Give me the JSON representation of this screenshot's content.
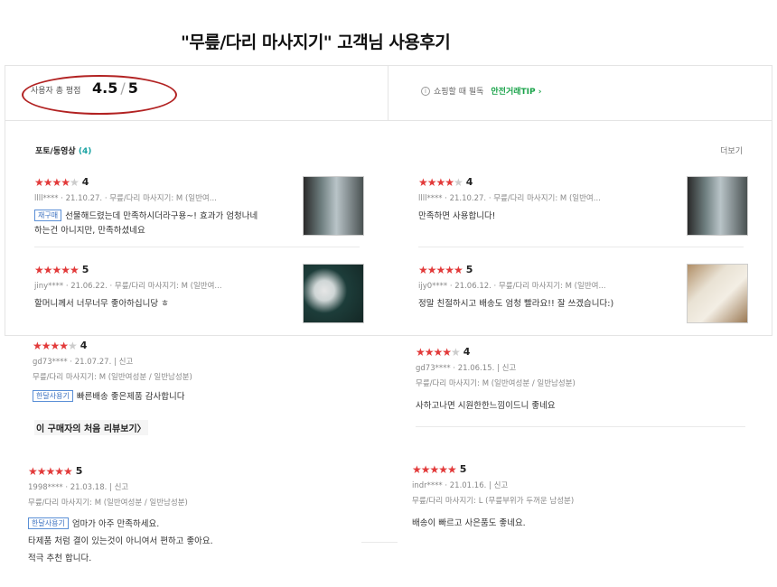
{
  "title": "\"무릎/다리 마사지기\" 고객님 사용후기",
  "summary": {
    "label": "사용자 총 평점",
    "score": "4.5",
    "max": "5",
    "tip_text": "쇼핑할 때 필독",
    "tip_link": "안전거래TIP"
  },
  "photo_section": {
    "label": "포토/동영상",
    "count": "(4)",
    "more": "더보기"
  },
  "photo_reviews": [
    {
      "stars": 4,
      "score": "4",
      "user": "llll****",
      "date": "21.10.27.",
      "option": "무릎/다리 마사지기: M (일반여...",
      "badge": "재구매",
      "text": "선물해드렸는데 만족하시더라구용~! 효과가 엄청나네 하는건 아니지만, 만족하셨네요"
    },
    {
      "stars": 4,
      "score": "4",
      "user": "llll****",
      "date": "21.10.27.",
      "option": "무릎/다리 마사지기: M (일반여...",
      "badge": "",
      "text": "만족하면 사용합니다!"
    },
    {
      "stars": 5,
      "score": "5",
      "user": "jiny****",
      "date": "21.06.22.",
      "option": "무릎/다리 마사지기: M (일반여...",
      "badge": "",
      "text": "할머니께서 너무너무 좋아하십니당 ㅎ"
    },
    {
      "stars": 5,
      "score": "5",
      "user": "ijy0****",
      "date": "21.06.12.",
      "option": "무릎/다리 마사지기: M (일반여...",
      "badge": "",
      "text": "정말 친절하시고 배송도 엄청 빨라요!! 잘 쓰겠습니다:)"
    }
  ],
  "text_reviews": [
    {
      "stars": 4,
      "score": "4",
      "user": "gd73****",
      "date": "21.07.27.",
      "report": "신고",
      "option": "무릎/다리 마사지기: M (일반여성분 / 일반남성분)",
      "badge": "한달사용기",
      "text": "빠른배송 좋은제품 감사합니다"
    },
    {
      "stars": 4,
      "score": "4",
      "user": "gd73****",
      "date": "21.06.15.",
      "report": "신고",
      "option": "무릎/다리 마사지기: M (일반여성분 / 일반남성분)",
      "badge": "",
      "text": "사하고나면 시원한한느낌이드니 좋네요"
    },
    {
      "stars": 5,
      "score": "5",
      "user": "1998****",
      "date": "21.03.18.",
      "report": "신고",
      "option": "무릎/다리 마사지기: M (일반여성분 / 일반남성분)",
      "badge": "한달사용기",
      "text": "엄마가  아주 만족하세요.",
      "text2": "타제품 처럼 결이 있는것이 아니여서 편하고 좋아요.",
      "text3": "적극 추천 합니다."
    },
    {
      "stars": 5,
      "score": "5",
      "user": "indr****",
      "date": "21.01.16.",
      "report": "신고",
      "option": "무릎/다리 마사지기: L (무릎부위가 두꺼운 남성분)",
      "badge": "",
      "text": "배송이 빠르고 사은품도 좋네요."
    }
  ],
  "first_review_link": "이 구매자의 처음 리뷰보기",
  "colors": {
    "star": "#e23a3a",
    "accent_green": "#1aa34a",
    "badge_blue": "#3a70c0",
    "circle": "#b22222"
  }
}
